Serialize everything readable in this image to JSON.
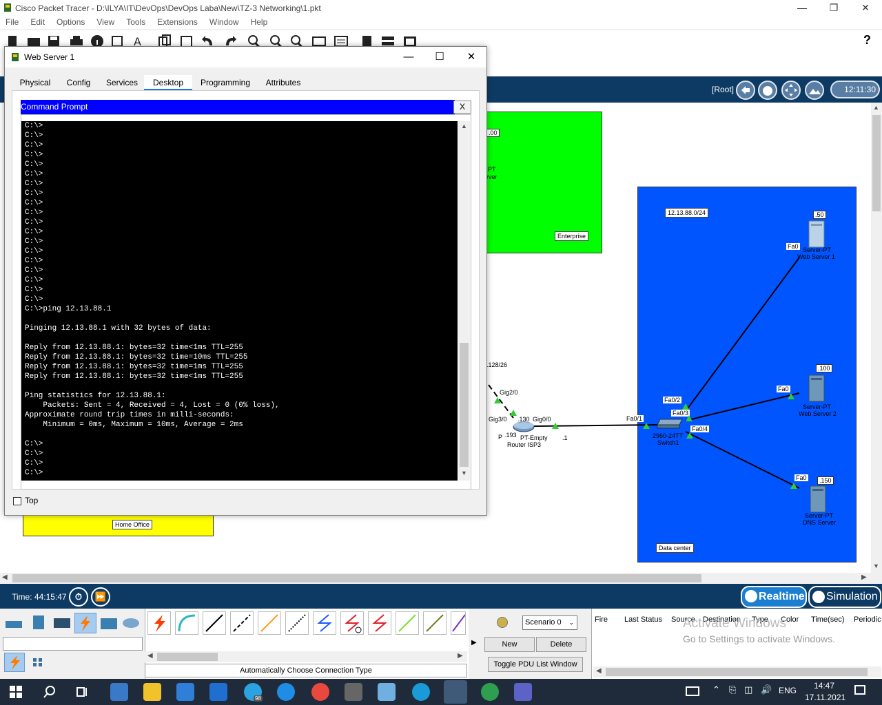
{
  "app": {
    "title": "Cisco Packet Tracer - D:\\ILYA\\IT\\DevOps\\DevOps Laba\\New\\TZ-3 Networking\\1.pkt",
    "menu": [
      "File",
      "Edit",
      "Options",
      "View",
      "Tools",
      "Extensions",
      "Window",
      "Help"
    ],
    "help_glyph": "?"
  },
  "workspace_bar": {
    "root_label": "[Root]",
    "clock": "12:11:30"
  },
  "topology": {
    "enterprise_label": "Enterprise",
    "enterprise_partial_ip": ".00",
    "enterprise_partial_pt": "PT",
    "enterprise_partial_server": "rver",
    "home_office_label": "Home Office",
    "datacenter_label": "Data center",
    "datacenter_subnet": "12.13.88.0/24",
    "partial_subnet": ".128/26",
    "router": {
      "port_gig2": "Gig2/0",
      "port_gig3": "Gig3/0",
      "ip_130": ".130",
      "port_gig0": "Gig0/0",
      "ip_193": ".193",
      "p_fragment": "P",
      "model": "PT-Empty",
      "name": "Router ISP3",
      "ip_1": ".1"
    },
    "switch": {
      "fa01": "Fa0/1",
      "fa02": "Fa0/2",
      "fa03": "Fa0/3",
      "fa04": "Fa0/4",
      "model": "2960-24TT",
      "name": "Switch1"
    },
    "web1": {
      "ip": ".50",
      "port": "Fa0",
      "model": "Server-PT",
      "name": "Web Server 1"
    },
    "web2": {
      "ip": ".100",
      "port": "Fa0",
      "model": "Server-PT",
      "name": "Web Server 2"
    },
    "dns": {
      "ip": ".150",
      "port": "Fa0",
      "model": "Server-PT",
      "name": "DNS Server"
    }
  },
  "timebar": {
    "time_label": "Time: 44:15:47",
    "realtime": "Realtime",
    "simulation": "Simulation"
  },
  "lower_panel": {
    "conn_type_label": "Automatically Choose Connection Type",
    "scenario": "Scenario 0",
    "new_button": "New",
    "delete_button": "Delete",
    "toggle_button": "Toggle PDU List Window",
    "pdu_columns": [
      "Fire",
      "Last Status",
      "Source",
      "Destination",
      "Type",
      "Color",
      "Time(sec)",
      "Periodic"
    ],
    "activate_line1": "Activate Windows",
    "activate_line2": "Go to Settings to activate Windows."
  },
  "taskbar": {
    "lang": "ENG",
    "time": "14:47",
    "date": "17.11.2021",
    "badge": "98"
  },
  "dialog": {
    "title": "Web Server 1",
    "tabs": [
      "Physical",
      "Config",
      "Services",
      "Desktop",
      "Programming",
      "Attributes"
    ],
    "active_tab": "Desktop",
    "cmd_title": "Command Prompt",
    "cmd_close": "X",
    "top_checkbox_label": "Top",
    "terminal_lines": [
      "C:\\>",
      "C:\\>",
      "C:\\>",
      "C:\\>",
      "C:\\>",
      "C:\\>",
      "C:\\>",
      "C:\\>",
      "C:\\>",
      "C:\\>",
      "C:\\>",
      "C:\\>",
      "C:\\>",
      "C:\\>",
      "C:\\>",
      "C:\\>",
      "C:\\>",
      "C:\\>",
      "C:\\>",
      "C:\\>ping 12.13.88.1",
      "",
      "Pinging 12.13.88.1 with 32 bytes of data:",
      "",
      "Reply from 12.13.88.1: bytes=32 time<1ms TTL=255",
      "Reply from 12.13.88.1: bytes=32 time=10ms TTL=255",
      "Reply from 12.13.88.1: bytes=32 time=1ms TTL=255",
      "Reply from 12.13.88.1: bytes=32 time<1ms TTL=255",
      "",
      "Ping statistics for 12.13.88.1:",
      "    Packets: Sent = 4, Received = 4, Lost = 0 (0% loss),",
      "Approximate round trip times in milli-seconds:",
      "    Minimum = 0ms, Maximum = 10ms, Average = 2ms",
      "",
      "C:\\>",
      "C:\\>",
      "C:\\>",
      "C:\\>"
    ]
  }
}
